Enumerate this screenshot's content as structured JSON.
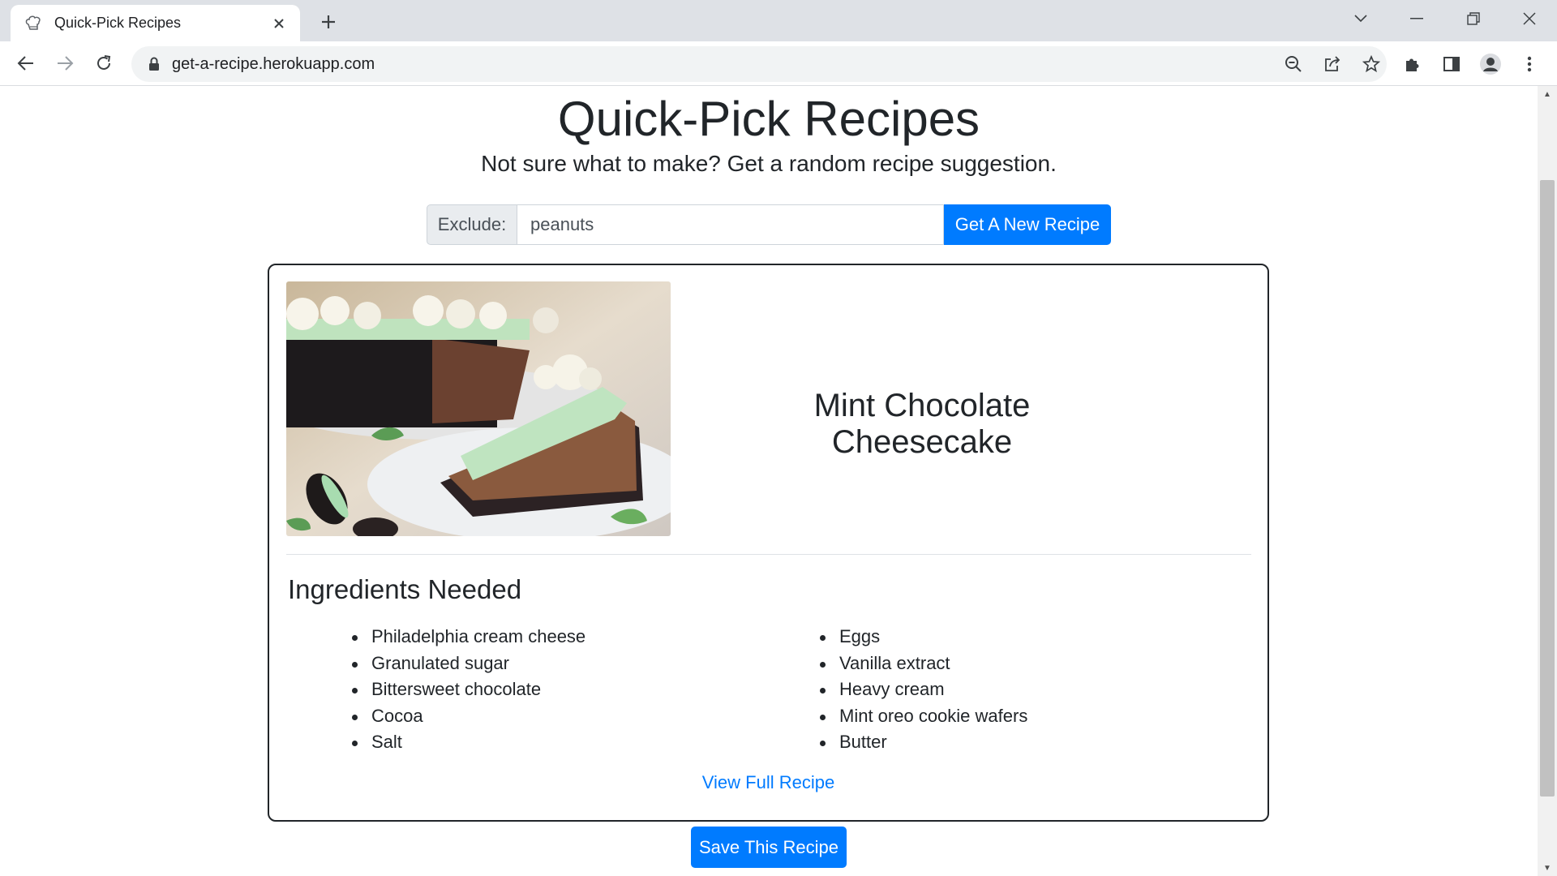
{
  "browser": {
    "tab_title": "Quick-Pick Recipes",
    "url": "get-a-recipe.herokuapp.com"
  },
  "page": {
    "title": "Quick-Pick Recipes",
    "subtitle": "Not sure what to make? Get a random recipe suggestion.",
    "exclude_label": "Exclude:",
    "exclude_value": "peanuts",
    "new_recipe_button": "Get A New Recipe",
    "save_button": "Save This Recipe"
  },
  "recipe": {
    "name": "Mint Chocolate Cheesecake",
    "ingredients_heading": "Ingredients Needed",
    "ingredients_col1": [
      "Philadelphia cream cheese",
      "Granulated sugar",
      "Bittersweet chocolate",
      "Cocoa",
      "Salt"
    ],
    "ingredients_col2": [
      "Eggs",
      "Vanilla extract",
      "Heavy cream",
      "Mint oreo cookie wafers",
      "Butter"
    ],
    "full_recipe_link": "View Full Recipe"
  },
  "colors": {
    "primary": "#007bff",
    "text": "#212529",
    "chrome_bg": "#dee1e6"
  },
  "icons": [
    "chef-hat-icon",
    "close-icon",
    "plus-icon",
    "chevron-down-icon",
    "minimize-icon",
    "restore-icon",
    "back-icon",
    "forward-icon",
    "reload-icon",
    "lock-icon",
    "zoom-out-icon",
    "share-icon",
    "star-icon",
    "extensions-icon",
    "side-panel-icon",
    "profile-icon",
    "menu-icon"
  ]
}
